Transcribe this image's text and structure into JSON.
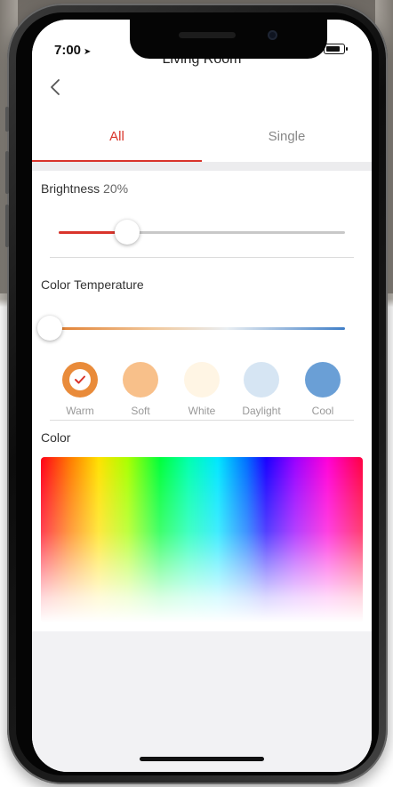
{
  "status_bar": {
    "time": "7:00",
    "location_icon": "location-arrow-icon",
    "signal_icon": "cellular-signal-icon",
    "wifi_icon": "wifi-icon",
    "battery_icon": "battery-icon"
  },
  "nav": {
    "back_icon": "chevron-left-icon",
    "title": "Living Room"
  },
  "tabs": [
    {
      "label": "All",
      "active": true
    },
    {
      "label": "Single",
      "active": false
    }
  ],
  "brightness": {
    "label": "Brightness",
    "value_text": "20%",
    "value": 0.2
  },
  "color_temperature": {
    "label": "Color Temperature",
    "value": 0.0,
    "presets": [
      {
        "label": "Warm",
        "color": "#e98b3a",
        "selected": true
      },
      {
        "label": "Soft",
        "color": "#f8c08a",
        "selected": false
      },
      {
        "label": "White",
        "color": "#fff5e4",
        "selected": false
      },
      {
        "label": "Daylight",
        "color": "#d6e5f3",
        "selected": false
      },
      {
        "label": "Cool",
        "color": "#6a9fd6",
        "selected": false
      }
    ]
  },
  "color": {
    "label": "Color"
  },
  "colors": {
    "accent": "#d9342b",
    "slider_track": "#c8c8c8"
  }
}
